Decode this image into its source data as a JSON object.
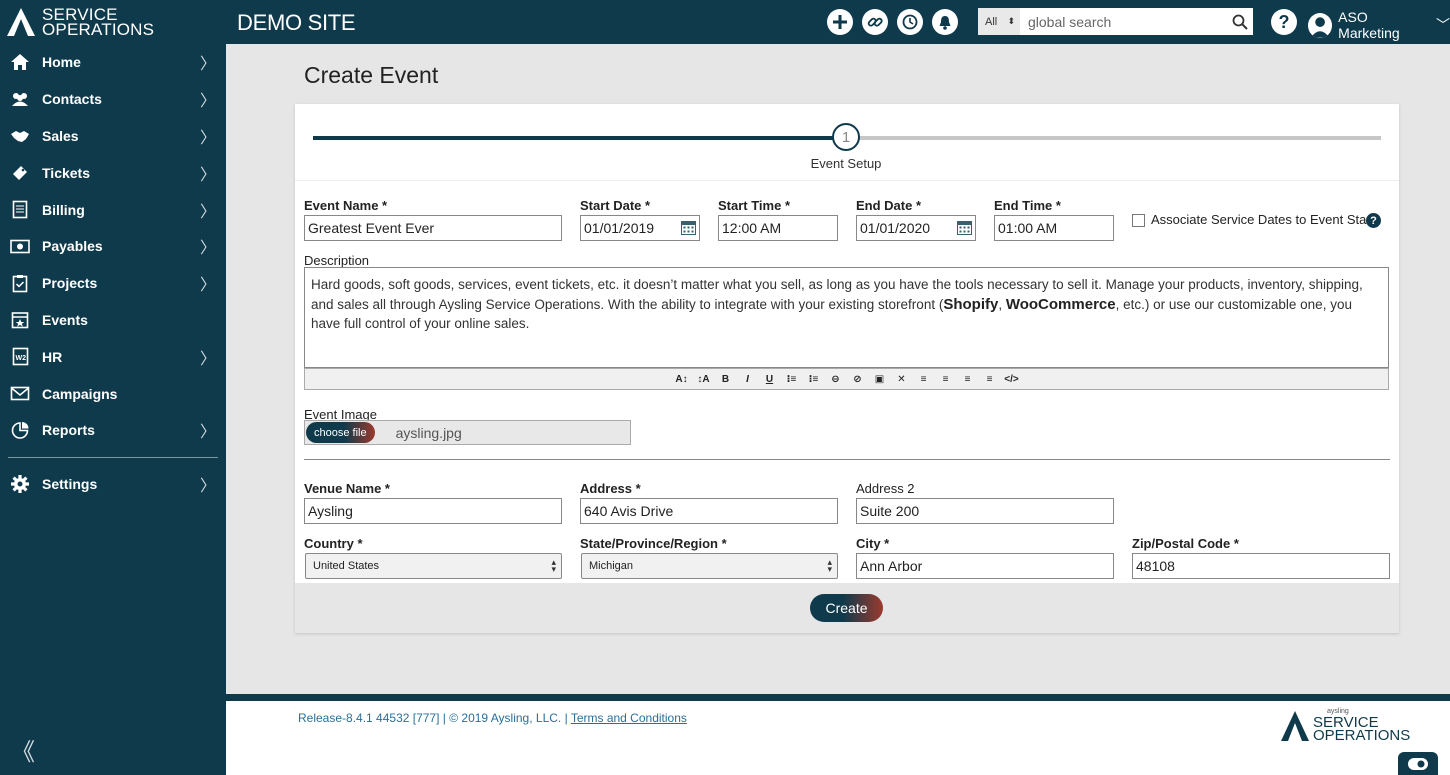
{
  "brand": {
    "line1": "SERVICE",
    "line2": "OPERATIONS"
  },
  "sidebar": {
    "items": [
      {
        "label": "Home",
        "icon": "home-icon",
        "chevron": true
      },
      {
        "label": "Contacts",
        "icon": "contacts-icon",
        "chevron": true
      },
      {
        "label": "Sales",
        "icon": "handshake-icon",
        "chevron": true
      },
      {
        "label": "Tickets",
        "icon": "ticket-icon",
        "chevron": true
      },
      {
        "label": "Billing",
        "icon": "billing-icon",
        "chevron": true
      },
      {
        "label": "Payables",
        "icon": "payables-icon",
        "chevron": true
      },
      {
        "label": "Projects",
        "icon": "clipboard-icon",
        "chevron": true
      },
      {
        "label": "Events",
        "icon": "calendar-star-icon",
        "chevron": false
      },
      {
        "label": "HR",
        "icon": "w2-icon",
        "chevron": true
      },
      {
        "label": "Campaigns",
        "icon": "envelope-icon",
        "chevron": false
      },
      {
        "label": "Reports",
        "icon": "reports-icon",
        "chevron": true
      }
    ],
    "settings": {
      "label": "Settings",
      "icon": "gear-icon"
    },
    "collapse_glyph": "《"
  },
  "topbar": {
    "site_title": "DEMO SITE",
    "search": {
      "scope": "All",
      "placeholder": "global search"
    },
    "help_glyph": "?",
    "user_name": "ASO Marketing",
    "user_caret": "﹀"
  },
  "page": {
    "title": "Create Event"
  },
  "stepper": {
    "step_number": "1",
    "step_label": "Event Setup"
  },
  "form": {
    "event_name": {
      "label": "Event Name *",
      "value": "Greatest Event Ever"
    },
    "start_date": {
      "label": "Start Date *",
      "value": "01/01/2019"
    },
    "start_time": {
      "label": "Start Time *",
      "value": "12:00 AM"
    },
    "end_date": {
      "label": "End Date *",
      "value": "01/01/2020"
    },
    "end_time": {
      "label": "End Time *",
      "value": "01:00 AM"
    },
    "associate": {
      "label": "Associate Service Dates to Event Start",
      "checked": false,
      "help": "?"
    },
    "description": {
      "label": "Description",
      "part1": "Hard goods, soft goods, services, event tickets, etc. it doesn’t matter what you sell, as long as you have the tools necessary to sell it. Manage your products, inventory, shipping, and sales all through Aysling Service Operations. With the ability to integrate with your existing storefront (",
      "brand1": "Shopify",
      "comma": ", ",
      "brand2": "WooCommerce",
      "part2": ", etc.) or use our customizable one, you have full control of your online sales."
    },
    "toolbar": [
      "A↕",
      "↕A",
      "B",
      "I",
      "U",
      "⁝≡",
      "⁝≡",
      "⊖",
      "⊘",
      "▣",
      "✕",
      "≡",
      "≡",
      "≡",
      "≡",
      "</>"
    ],
    "event_image": {
      "label": "Event Image",
      "button": "choose file",
      "file_name": "aysling.jpg"
    },
    "venue_name": {
      "label": "Venue Name *",
      "value": "Aysling"
    },
    "address": {
      "label": "Address *",
      "value": "640 Avis Drive"
    },
    "address2": {
      "label": "Address 2",
      "value": "Suite 200"
    },
    "country": {
      "label": "Country *",
      "value": "United States"
    },
    "state": {
      "label": "State/Province/Region *",
      "value": "Michigan"
    },
    "city": {
      "label": "City *",
      "value": "Ann Arbor"
    },
    "zip": {
      "label": "Zip/Postal Code *",
      "value": "48108"
    },
    "submit": "Create"
  },
  "footer": {
    "release": "Release-8.4.1 44532 [777] | © 2019 Aysling, LLC. |",
    "terms": "Terms and Conditions",
    "logo_small": "aysling",
    "logo_line1": "SERVICE",
    "logo_line2": "OPERATIONS"
  },
  "colors": {
    "primary": "#0f3a4b",
    "accent": "#9b3a2e",
    "link": "#2a6f9a",
    "background": "#e6e6e6"
  }
}
